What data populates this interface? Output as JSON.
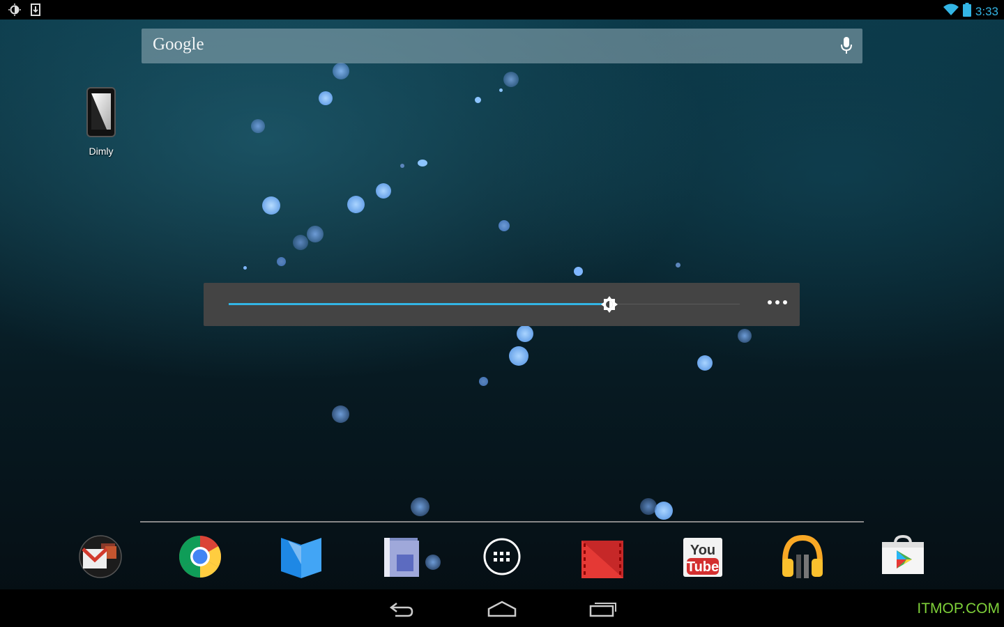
{
  "status_bar": {
    "left_icons": [
      "brightness-icon",
      "download-icon"
    ],
    "right_icons": [
      "wifi-icon",
      "battery-icon"
    ],
    "time": "3:33"
  },
  "search": {
    "logo": "Google",
    "mic_icon": "microphone-icon"
  },
  "desktop": {
    "shortcut": {
      "label": "Dimly",
      "icon": "dimly-app-icon"
    }
  },
  "brightness_widget": {
    "level": 0.745,
    "thumb_icon": "brightness-icon",
    "menu_icon": "more-icon"
  },
  "dock": {
    "apps": [
      {
        "name": "gmail-folder-icon"
      },
      {
        "name": "chrome-icon"
      },
      {
        "name": "play-books-icon"
      },
      {
        "name": "magazines-icon"
      },
      {
        "name": "app-drawer-icon"
      },
      {
        "name": "play-movies-icon"
      },
      {
        "name": "youtube-icon",
        "text_top": "You",
        "text_bottom": "Tube"
      },
      {
        "name": "play-music-icon"
      },
      {
        "name": "play-store-icon"
      }
    ]
  },
  "nav_bar": {
    "buttons": [
      "back-icon",
      "home-icon",
      "recents-icon"
    ]
  },
  "watermark": "ITMOP.COM",
  "colors": {
    "accent": "#33b5e5",
    "watermark": "#7fd13a"
  }
}
